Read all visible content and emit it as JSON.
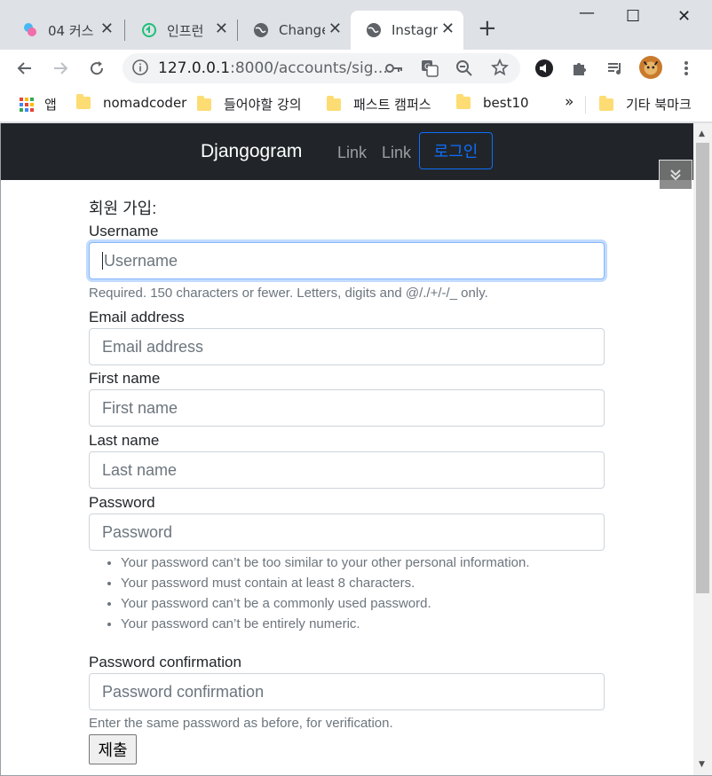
{
  "tabs": [
    {
      "title": "04 커스",
      "close": "✕"
    },
    {
      "title": "인프런",
      "close": "✕"
    },
    {
      "title": "Change",
      "close": "✕"
    },
    {
      "title": "Instagr",
      "close": "✕"
    }
  ],
  "new_tab": "+",
  "window_controls": {
    "minimize": "—",
    "maximize": "☐",
    "close": "✕"
  },
  "toolbar": {
    "url_host": "127.0.0.1",
    "url_rest": ":8000/accounts/sig..."
  },
  "bookmarks": {
    "apps_label": "앱",
    "items": [
      "nomadcoder",
      "들어야할 강의",
      "패스트 캠퍼스",
      "best10"
    ],
    "more": "»",
    "other": "기타 북마크"
  },
  "navbar": {
    "brand": "Djangogram",
    "link1": "Link",
    "link2": "Link",
    "login": "로그인"
  },
  "form": {
    "title": "회원 가입:",
    "username_label": "Username",
    "username_placeholder": "Username",
    "username_help": "Required. 150 characters or fewer. Letters, digits and @/./+/-/_ only.",
    "email_label": "Email address",
    "email_placeholder": "Email address",
    "first_label": "First name",
    "first_placeholder": "First name",
    "last_label": "Last name",
    "last_placeholder": "Last name",
    "password_label": "Password",
    "password_placeholder": "Password",
    "password_rules": [
      "Your password can’t be too similar to your other personal information.",
      "Your password must contain at least 8 characters.",
      "Your password can’t be a commonly used password.",
      "Your password can’t be entirely numeric."
    ],
    "confirm_label": "Password confirmation",
    "confirm_placeholder": "Password confirmation",
    "confirm_help": "Enter the same password as before, for verification.",
    "submit": "제출"
  },
  "colors": {
    "navbar_bg": "#212529",
    "primary": "#0d6efd",
    "muted": "#6c757d"
  }
}
